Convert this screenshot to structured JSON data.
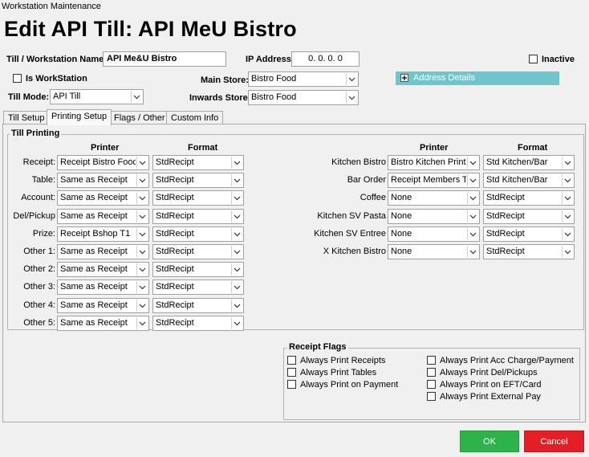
{
  "window": {
    "title": "Workstation Maintenance"
  },
  "header": {
    "title": "Edit API Till: API MeU Bistro"
  },
  "form": {
    "till_name_label": "Till / Workstation Name:",
    "till_name_value": "API Me&U Bistro",
    "ip_label": "IP Address:",
    "ip_value": "0.  0.  0.  0",
    "inactive_label": "Inactive",
    "is_workstation_label": "Is WorkStation",
    "main_store_label": "Main Store:",
    "main_store_value": "Bistro Food",
    "till_mode_label": "Till Mode:",
    "till_mode_value": "API Till",
    "inwards_store_label": "Inwards Store:",
    "inwards_store_value": "Bistro Food",
    "address_details_label": "Address Details"
  },
  "tabs": [
    "Till Setup",
    "Printing Setup",
    "Flags / Other",
    "Custom Info"
  ],
  "till_printing": {
    "title": "Till Printing",
    "printer_header": "Printer",
    "format_header": "Format",
    "left_rows": [
      {
        "label": "Receipt:",
        "printer": "Receipt Bistro Food",
        "format": "StdRecipt"
      },
      {
        "label": "Table:",
        "printer": "Same as Receipt",
        "format": "StdRecipt"
      },
      {
        "label": "Account:",
        "printer": "Same as Receipt",
        "format": "StdRecipt"
      },
      {
        "label": "Del/Pickup",
        "printer": "Same as Receipt",
        "format": "StdRecipt"
      },
      {
        "label": "Prize:",
        "printer": "Receipt Bshop T1",
        "format": "StdRecipt"
      },
      {
        "label": "Other 1:",
        "printer": "Same as Receipt",
        "format": "StdRecipt"
      },
      {
        "label": "Other 2:",
        "printer": "Same as Receipt",
        "format": "StdRecipt"
      },
      {
        "label": "Other 3:",
        "printer": "Same as Receipt",
        "format": "StdRecipt"
      },
      {
        "label": "Other 4:",
        "printer": "Same as Receipt",
        "format": "StdRecipt"
      },
      {
        "label": "Other 5:",
        "printer": "Same as Receipt",
        "format": "StdRecipt"
      }
    ],
    "right_rows": [
      {
        "label": "Kitchen Bistro",
        "printer": "Bistro Kitchen Print",
        "format": "Std Kitchen/Bar"
      },
      {
        "label": "Bar Order",
        "printer": "Receipt Members T",
        "format": "Std Kitchen/Bar"
      },
      {
        "label": "Coffee",
        "printer": "None",
        "format": "StdRecipt"
      },
      {
        "label": "Kitchen SV Pasta",
        "printer": "None",
        "format": "StdRecipt"
      },
      {
        "label": "Kitchen SV Entree",
        "printer": "None",
        "format": "StdRecipt"
      },
      {
        "label": "X Kitchen Bistro",
        "printer": "None",
        "format": "StdRecipt"
      }
    ]
  },
  "receipt_flags": {
    "title": "Receipt Flags",
    "left": [
      "Always Print Receipts",
      "Always Print Tables",
      "Always Print on Payment"
    ],
    "right": [
      "Always Print Acc Charge/Payment",
      "Always Print Del/Pickups",
      "Always Print on EFT/Card",
      "Always Print External Pay"
    ]
  },
  "buttons": {
    "ok": "OK",
    "cancel": "Cancel"
  },
  "colors": {
    "ok": "#2eb34a",
    "cancel": "#e51e25",
    "address_bar": "#6ec5cc"
  },
  "icons": {
    "dropdown": "chevron-down-icon",
    "expand": "plus-icon"
  }
}
